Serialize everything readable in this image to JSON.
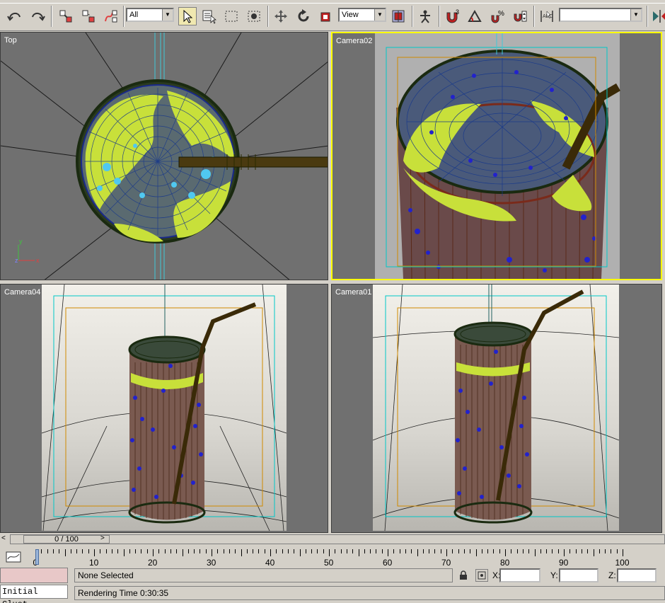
{
  "toolbar": {
    "selection_filter": "All",
    "reference_coord": "View",
    "named_selection": "",
    "snap_angle_label": "3",
    "percent_snap_label": "%"
  },
  "viewports": {
    "top_left": {
      "label": "Top"
    },
    "top_right": {
      "label": "Camera02"
    },
    "bottom_left": {
      "label": "Camera04"
    },
    "bottom_right": {
      "label": "Camera01"
    }
  },
  "axis_tripod": {
    "x": "x",
    "y": "y",
    "z": "z"
  },
  "time_slider": {
    "value": "0 / 100",
    "prev": "<",
    "next": ">"
  },
  "trackbar": {
    "ticks": [
      "0",
      "10",
      "20",
      "30",
      "40",
      "50",
      "60",
      "70",
      "80",
      "90",
      "100"
    ]
  },
  "status": {
    "script_listener": "Initial Clust",
    "selection": "None Selected",
    "prompt": "Rendering Time  0:30:35",
    "x_label": "X:",
    "y_label": "Y:",
    "z_label": "Z:",
    "x_value": "",
    "y_value": "",
    "z_value": ""
  },
  "colors": {
    "viewport_bg": "#707070",
    "active_border": "#ffff00",
    "glass_wire": "#1a2a10",
    "liquid_wire": "#7a3a28",
    "ice": "#c8e03a",
    "bubbles": "#2222cc",
    "safe_frame_cyan": "#00c8c8",
    "safe_frame_orange": "#d08a00"
  }
}
